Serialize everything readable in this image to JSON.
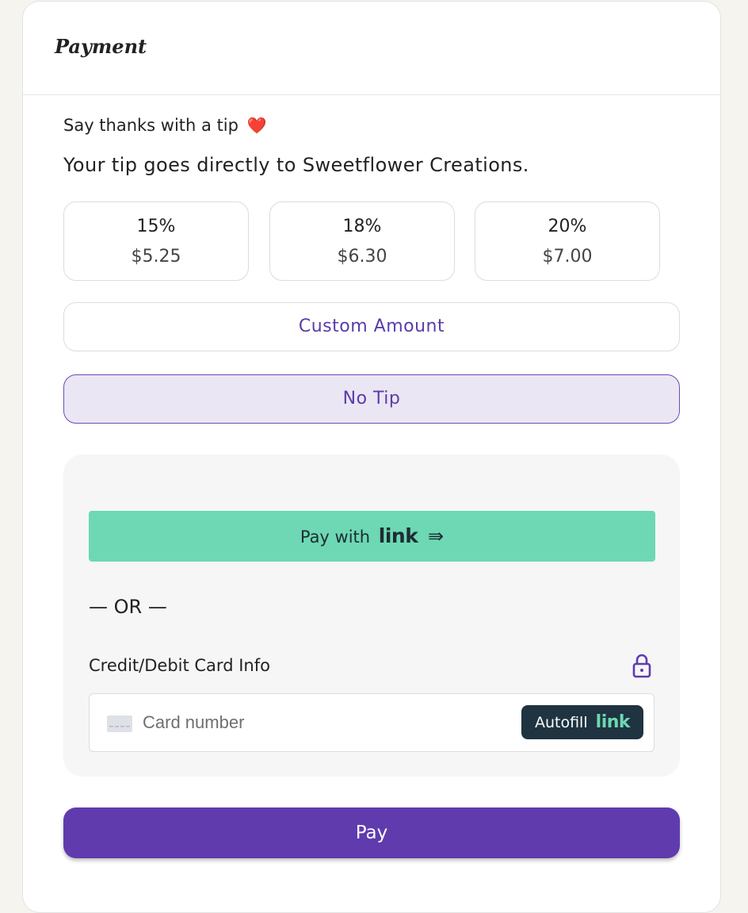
{
  "header": {
    "title": "Payment"
  },
  "tip": {
    "heading": "Say thanks with a tip",
    "heading_emoji": "❤️",
    "subheading": "Your tip goes directly to Sweetflower Creations.",
    "options": [
      {
        "percent": "15%",
        "amount": "$5.25"
      },
      {
        "percent": "18%",
        "amount": "$6.30"
      },
      {
        "percent": "20%",
        "amount": "$7.00"
      }
    ],
    "custom_label": "Custom Amount",
    "no_tip_label": "No Tip",
    "selected": "No Tip"
  },
  "payment": {
    "link_button_prefix": "Pay with",
    "link_logo": "link",
    "link_arrow": "⇛",
    "or_divider": "— OR —",
    "card_label": "Credit/Debit Card Info",
    "card_placeholder": "Card number",
    "autofill_label": "Autofill",
    "autofill_logo": "link",
    "pay_label": "Pay"
  },
  "colors": {
    "accent": "#5f3bae",
    "link_green": "#6dd8b3",
    "selected_bg": "#ebe6f4",
    "autofill_bg": "#1f3340"
  },
  "icons": {
    "heading": "heart-icon",
    "link_arrow": "arrow-right-icon",
    "secure": "lock-icon",
    "card": "credit-card-icon"
  }
}
